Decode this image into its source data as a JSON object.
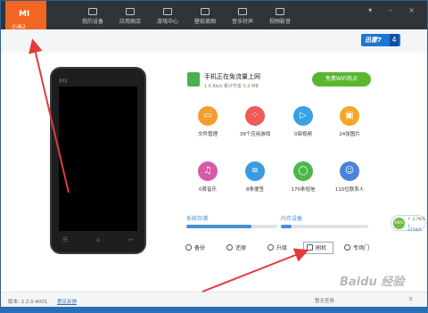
{
  "header": {
    "brand_logo": "MI",
    "brand_name": "小米2",
    "tabs": [
      {
        "label": "我的设备",
        "icon": "phone-icon"
      },
      {
        "label": "应用商店",
        "icon": "store-bag-icon"
      },
      {
        "label": "游戏中心",
        "icon": "gamepad-icon"
      },
      {
        "label": "壁纸美图",
        "icon": "image-icon"
      },
      {
        "label": "音乐铃声",
        "icon": "music-note-icon"
      },
      {
        "label": "视频影音",
        "icon": "video-icon"
      }
    ],
    "window_buttons": "▾ – ×",
    "promo_text": "迅雷7",
    "promo_badge": "4"
  },
  "phone": {
    "brand_mark": "MI",
    "keys": [
      "☰",
      "⌂",
      "↩"
    ]
  },
  "transfer": {
    "title": "手机正在免流量上网",
    "speed_value": "1.6",
    "speed_unit": "Kb/s",
    "saved_label": "累计节省",
    "saved_value": "0.2",
    "saved_unit": "MB",
    "wifi_button": "免费WiFi热点"
  },
  "grid": [
    {
      "label": "文件管理",
      "icon": "folder-icon",
      "color": "#f39c2f"
    },
    {
      "label": "39个应用游戏",
      "icon": "apps-grid-icon",
      "color": "#f05a5a"
    },
    {
      "label": "0部视频",
      "icon": "play-icon",
      "color": "#3aa0e8"
    },
    {
      "label": "24张图片",
      "icon": "picture-icon",
      "color": "#f5a623"
    },
    {
      "label": "0首音乐",
      "icon": "music-icon",
      "color": "#d65aa8"
    },
    {
      "label": "8条便签",
      "icon": "note-icon",
      "color": "#3a9be0"
    },
    {
      "label": "170条短信",
      "icon": "sms-icon",
      "color": "#4cb74a"
    },
    {
      "label": "110位联系人",
      "icon": "contact-icon",
      "color": "#4a83d8"
    }
  ],
  "storage": {
    "system_label": "系统存储",
    "system_fill": 0.72,
    "internal_label": "内存设备",
    "internal_fill": 0.12
  },
  "actions": [
    {
      "label": "备份",
      "icon": "backup-icon"
    },
    {
      "label": "还原",
      "icon": "restore-icon"
    },
    {
      "label": "升级",
      "icon": "upgrade-icon"
    },
    {
      "label": "刷机",
      "icon": "flash-icon"
    },
    {
      "label": "专场门",
      "icon": "send-icon"
    }
  ],
  "netmon": {
    "percent": "68%",
    "upload": "↑ 3.7K/S",
    "download": "↓ 211K/S"
  },
  "footer": {
    "version": "版本: 2.2.0.4001",
    "feedback": "意见反馈",
    "tasks": "暂无任务",
    "count": "0"
  },
  "watermark": "Baidu 经验",
  "colors": {
    "accent": "#f26522",
    "header": "#2f3439",
    "annotation_arrow": "#e23b3b"
  }
}
